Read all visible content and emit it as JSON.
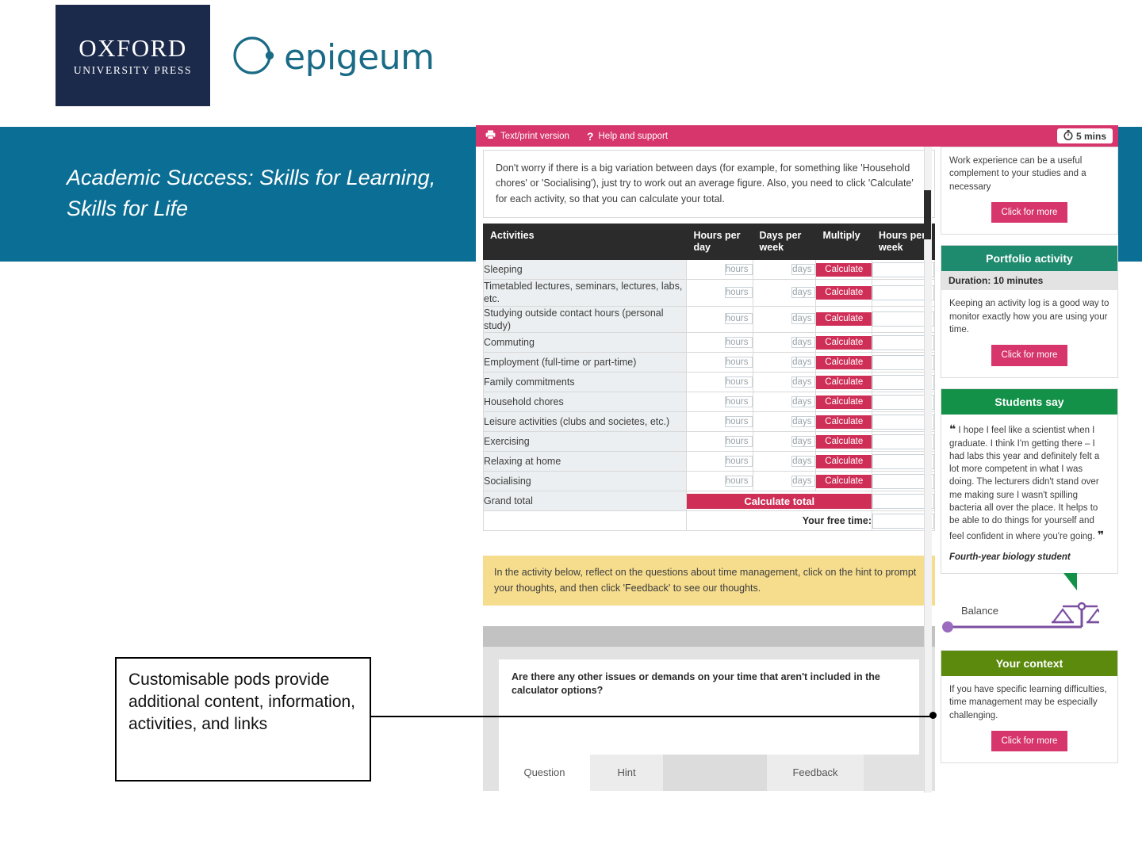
{
  "brand": {
    "oup_line1": "OXFORD",
    "oup_line2": "UNIVERSITY PRESS",
    "epigeum": "epigeum",
    "blue": "#0b6e94",
    "pink": "#d6366b"
  },
  "slide": {
    "title": "Academic Success: Skills for Learning, Skills for Life"
  },
  "annotation": {
    "text": "Customisable pods provide additional content, information, activities, and links"
  },
  "app": {
    "toolbar": {
      "print_icon": "printer-icon",
      "print_label": "Text/print version",
      "help_icon": "question-mark-icon",
      "help_label": "Help and support",
      "timer_icon": "stopwatch-icon",
      "timer_label": "5 mins"
    },
    "intro_note": "Don't worry if there is a big variation between days (for example, for something like 'Household chores' or 'Socialising'), just try to work out an average figure. Also, you need to click 'Calculate' for each activity, so that you can calculate your total.",
    "table": {
      "headers": [
        "Activities",
        "Hours per day",
        "Days per week",
        "Multiply",
        "Hours per week"
      ],
      "hours_placeholder": "hours",
      "days_placeholder": "days",
      "calculate_label": "Calculate",
      "rows": [
        "Sleeping",
        "Timetabled lectures, seminars, lectures, labs, etc.",
        "Studying outside contact hours (personal study)",
        "Commuting",
        "Employment (full-time or part-time)",
        "Family commitments",
        "Household chores",
        "Leisure activities (clubs and societes, etc.)",
        "Exercising",
        "Relaxing at home",
        "Socialising"
      ],
      "grand_total_label": "Grand total",
      "calculate_total_label": "Calculate total",
      "free_time_label": "Your free time:"
    },
    "yellow_note": "In the activity below, reflect on the questions about time management, click on the hint to prompt your thoughts, and then click 'Feedback' to see our thoughts.",
    "activity": {
      "question": "Are there any other issues or demands on your time that aren't included in the calculator options?",
      "tabs": [
        "Question",
        "Hint",
        "Feedback"
      ]
    },
    "pods": [
      {
        "id": "work-experience",
        "header": null,
        "header_color": null,
        "subhead": null,
        "body": "Work experience can be a useful complement to your studies and a necessary",
        "button": "Click for more"
      },
      {
        "id": "portfolio-activity",
        "header": "Portfolio activity",
        "header_color": "#1e8a6e",
        "subhead": "Duration: 10 minutes",
        "body": "Keeping an activity log is a good way to monitor exactly how you are using your time.",
        "button": "Click for more"
      },
      {
        "id": "students-say",
        "header": "Students say",
        "header_color": "#149148",
        "subhead": null,
        "body": "I hope I feel like a scientist when I graduate. I think I'm getting there – I had labs this year and definitely felt a lot more competent in what I was doing. The lecturers didn't stand over me making sure I wasn't spilling bacteria all over the place. It helps to be able to do things for yourself and feel confident in where you're going.",
        "attribution": "Fourth-year biology student",
        "button": null
      },
      {
        "id": "your-context",
        "header": "Your context",
        "header_color": "#5b8a0d",
        "subhead": null,
        "body": "If you have specific learning difficulties, time management may be especially challenging.",
        "button": "Click for more"
      }
    ],
    "balance_widget": {
      "label": "Balance",
      "icon": "scales-icon",
      "color": "#7b4fa0"
    }
  }
}
